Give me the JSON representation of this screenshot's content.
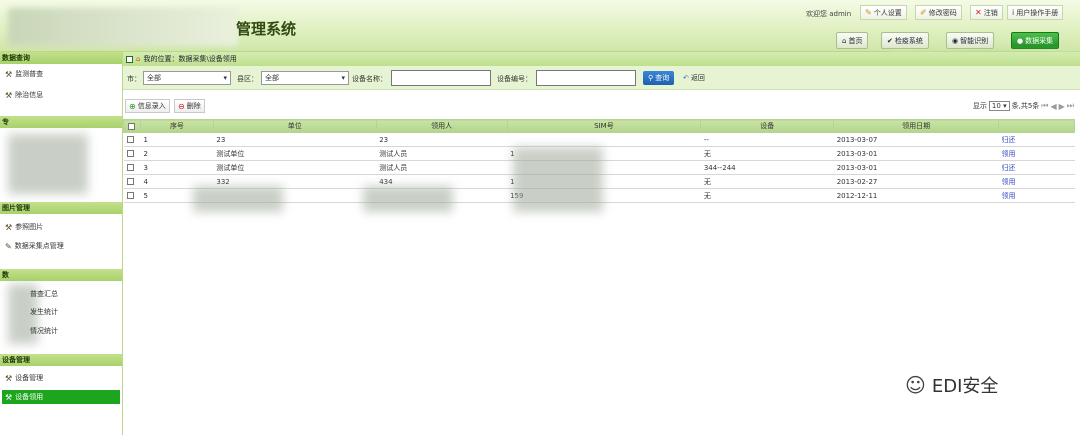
{
  "header": {
    "title": "管理系统",
    "welcome": "欢迎您 admin",
    "top_links": [
      {
        "icon": "edit-icon",
        "label": "个人设置"
      },
      {
        "icon": "pencil-icon",
        "label": "修改密码"
      },
      {
        "icon": "x-icon",
        "label": "注销"
      },
      {
        "icon": "info-icon",
        "label": "用户操作手册"
      }
    ],
    "nav": [
      {
        "icon": "home-icon",
        "label": "首页",
        "active": false
      },
      {
        "icon": "check-icon",
        "label": "检疫系统",
        "active": false
      },
      {
        "icon": "recognize-icon",
        "label": "智能识别",
        "active": false
      },
      {
        "icon": "user-icon",
        "label": "数据采集",
        "active": true
      }
    ]
  },
  "sidebar": {
    "sections": [
      {
        "title": "数据查询",
        "items": [
          {
            "label": "监测普查"
          },
          {
            "label": "除治信息"
          }
        ]
      },
      {
        "title": "专",
        "items": []
      },
      {
        "title": "图片管理",
        "items": [
          {
            "label": "参照图片"
          },
          {
            "label": "数据采集点管理"
          }
        ]
      },
      {
        "title": "数",
        "items": [
          {
            "label": "普查汇总"
          },
          {
            "label": "发生统计"
          },
          {
            "label": "情况统计"
          }
        ]
      },
      {
        "title": "设备管理",
        "items": [
          {
            "label": "设备管理"
          },
          {
            "label": "设备领用",
            "active": true
          }
        ]
      }
    ]
  },
  "breadcrumb": {
    "icon": "home-icon",
    "text": "我的位置：数据采集\\设备领用"
  },
  "filter": {
    "city_label": "市：",
    "city_value": "全部",
    "district_label": "县区：",
    "district_value": "全部",
    "device_name_label": "设备名称：",
    "device_no_label": "设备编号：",
    "query_label": "查询",
    "return_label": "返回"
  },
  "actions": {
    "add_label": "信息录入",
    "delete_label": "删除"
  },
  "pagination": {
    "show_prefix": "显示",
    "page_size": "10",
    "total_text": "条,共5条"
  },
  "table": {
    "headers": [
      "序号",
      "单位",
      "领用人",
      "SIM号",
      "设备",
      "领用日期"
    ],
    "rows": [
      {
        "no": "1",
        "unit": "23",
        "person": "23",
        "sim": "",
        "device": "--",
        "date": "2013-03-07",
        "action": "归还"
      },
      {
        "no": "2",
        "unit": "测试单位",
        "person": "测试人员",
        "sim": "1",
        "device": "无",
        "date": "2013-03-01",
        "action": "领用"
      },
      {
        "no": "3",
        "unit": "测试单位",
        "person": "测试人员",
        "sim": "",
        "device": "344--244",
        "date": "2013-03-01",
        "action": "归还"
      },
      {
        "no": "4",
        "unit": "332",
        "person": "434",
        "sim": "1",
        "device": "无",
        "date": "2013-02-27",
        "action": "领用"
      },
      {
        "no": "5",
        "unit": "",
        "person": "",
        "sim": "159",
        "device": "无",
        "date": "2012-12-11",
        "action": "领用"
      }
    ]
  },
  "watermark": {
    "text": "EDI安全"
  }
}
